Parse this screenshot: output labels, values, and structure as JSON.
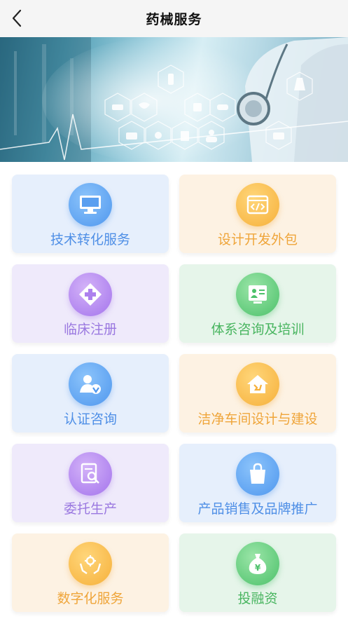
{
  "nav": {
    "title": "药械服务",
    "back_icon": "chevron-left-icon"
  },
  "banner": {
    "description_icon_set": [
      "pill-icon",
      "heart-rate-icon",
      "syringe-icon",
      "first-aid-kit-icon",
      "clipboard-icon",
      "stethoscope-icon",
      "ambulance-icon",
      "doctor-icon",
      "microscope-icon"
    ]
  },
  "services": [
    {
      "label": "技术转化服务",
      "icon": "monitor-icon",
      "theme": "blue"
    },
    {
      "label": "设计开发外包",
      "icon": "code-window-icon",
      "theme": "orange"
    },
    {
      "label": "临床注册",
      "icon": "medical-cross-icon",
      "theme": "purple"
    },
    {
      "label": "体系咨询及培训",
      "icon": "presentation-board-icon",
      "theme": "green"
    },
    {
      "label": "认证咨询",
      "icon": "verified-user-icon",
      "theme": "blue"
    },
    {
      "label": "洁净车间设计与建设",
      "icon": "house-build-icon",
      "theme": "orange"
    },
    {
      "label": "委托生产",
      "icon": "document-search-icon",
      "theme": "purple"
    },
    {
      "label": "产品销售及品牌推广",
      "icon": "shopping-bag-icon",
      "theme": "blue"
    },
    {
      "label": "数字化服务",
      "icon": "digital-hands-icon",
      "theme": "orange"
    },
    {
      "label": "投融资",
      "icon": "money-bag-icon",
      "theme": "green"
    }
  ],
  "colors": {
    "blue": "#4f8fe6",
    "orange": "#efa53a",
    "purple": "#9a78e0",
    "green": "#49b560"
  }
}
